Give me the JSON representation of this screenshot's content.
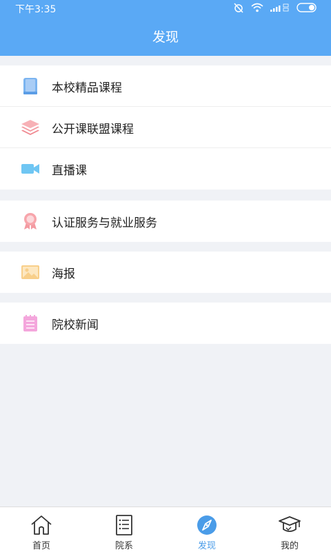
{
  "status_bar": {
    "time": "下午3:35"
  },
  "header": {
    "title": "发现"
  },
  "groups": [
    {
      "items": [
        {
          "label": "本校精品课程",
          "icon": "book-icon"
        },
        {
          "label": "公开课联盟课程",
          "icon": "layers-icon"
        },
        {
          "label": "直播课",
          "icon": "video-camera-icon"
        }
      ]
    },
    {
      "items": [
        {
          "label": "认证服务与就业服务",
          "icon": "award-ribbon-icon"
        }
      ]
    },
    {
      "items": [
        {
          "label": "海报",
          "icon": "image-icon"
        }
      ]
    },
    {
      "items": [
        {
          "label": "院校新闻",
          "icon": "notepad-icon"
        }
      ]
    }
  ],
  "tabbar": [
    {
      "label": "首页",
      "icon": "home-icon",
      "active": false
    },
    {
      "label": "院系",
      "icon": "list-document-icon",
      "active": false
    },
    {
      "label": "发现",
      "icon": "compass-icon",
      "active": true
    },
    {
      "label": "我的",
      "icon": "graduation-cap-icon",
      "active": false
    }
  ],
  "colors": {
    "primary": "#5aa9f5",
    "active_tab": "#4a9ce8",
    "background": "#f0f2f6"
  }
}
